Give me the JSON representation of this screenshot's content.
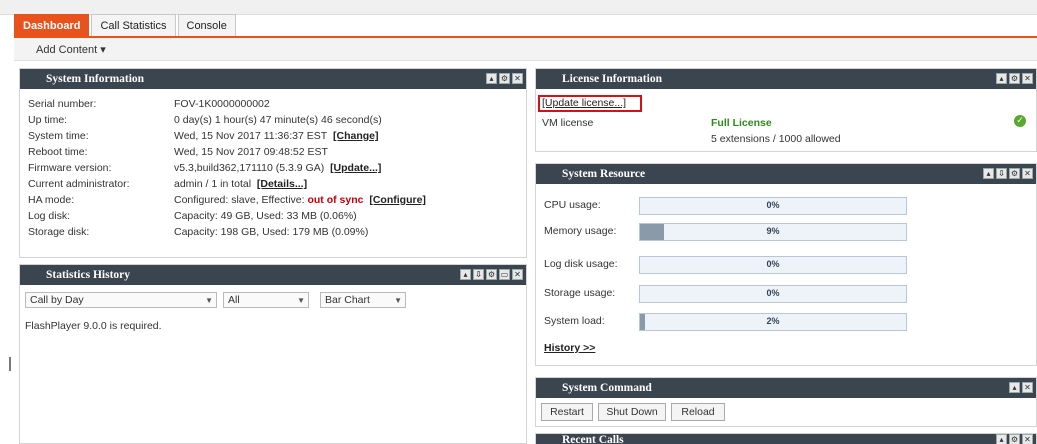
{
  "tabs": [
    {
      "label": "Dashboard"
    },
    {
      "label": "Call Statistics"
    },
    {
      "label": "Console"
    }
  ],
  "add_content": {
    "label": "Add Content ▾"
  },
  "system_info": {
    "title": "System Information",
    "rows": [
      {
        "label": "Serial number:",
        "value": "FOV-1K0000000002"
      },
      {
        "label": "Up time:",
        "value": "0 day(s) 1 hour(s) 47 minute(s) 46 second(s)"
      },
      {
        "label": "System time:",
        "value": "Wed, 15 Nov 2017 11:36:37 EST",
        "link": "[Change]"
      },
      {
        "label": "Reboot time:",
        "value": "Wed, 15 Nov 2017 09:48:52 EST"
      },
      {
        "label": "Firmware version:",
        "value": "v5.3,build362,171110 (5.3.9 GA)",
        "link": "[Update...]"
      },
      {
        "label": "Current administrator:",
        "value": "admin / 1 in total",
        "link": "[Details...]"
      },
      {
        "label": "HA mode:",
        "value": "Configured: slave, Effective:",
        "status": "out of sync",
        "link": "[Configure]"
      },
      {
        "label": "Log disk:",
        "value": "Capacity: 49 GB, Used: 33 MB (0.06%)"
      },
      {
        "label": "Storage disk:",
        "value": "Capacity: 198 GB, Used: 179 MB (0.09%)"
      }
    ]
  },
  "stats_history": {
    "title": "Statistics History",
    "select_period": "Call by Day",
    "select_scope": "All",
    "select_chart": "Bar Chart",
    "message": "FlashPlayer 9.0.0 is required."
  },
  "license": {
    "title": "License Information",
    "update_link": "[Update license...]",
    "vm_label": "VM license",
    "vm_status": "Full License",
    "vm_detail": "5 extensions / 1000 allowed",
    "status_color": "#2e8b1a"
  },
  "system_resource": {
    "title": "System Resource",
    "items": [
      {
        "label": "CPU usage:",
        "value": "0%",
        "fraction": 0.0
      },
      {
        "label": "Memory usage:",
        "value": "9%",
        "fraction": 0.09
      },
      {
        "label": "Log disk usage:",
        "value": "0%",
        "fraction": 0.0
      },
      {
        "label": "Storage usage:",
        "value": "0%",
        "fraction": 0.0
      },
      {
        "label": "System load:",
        "value": "2%",
        "fraction": 0.02
      }
    ],
    "history_link": "History >>"
  },
  "system_command": {
    "title": "System Command",
    "buttons": [
      "Restart",
      "Shut Down",
      "Reload"
    ]
  },
  "recent_calls": {
    "title": "Recent Calls"
  },
  "colors": {
    "accent": "#e8521c",
    "panel_header": "#3b4550",
    "alert": "#c8000a"
  }
}
